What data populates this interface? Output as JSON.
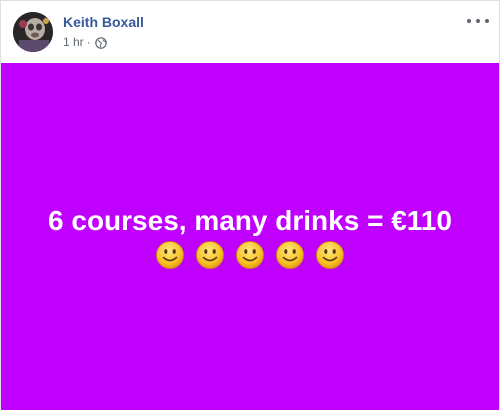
{
  "post": {
    "author": "Keith Boxall",
    "timestamp": "1 hr",
    "separator": "·",
    "privacy_icon": "globe-icon",
    "menu_icon": "more-options-icon",
    "text": "6 courses, many drinks = €110",
    "emojis": [
      "smile-icon",
      "smile-icon",
      "smile-icon",
      "smile-icon",
      "smile-icon"
    ],
    "background_color": "#c000ff",
    "text_color": "#ffffff",
    "author_color": "#385898"
  }
}
